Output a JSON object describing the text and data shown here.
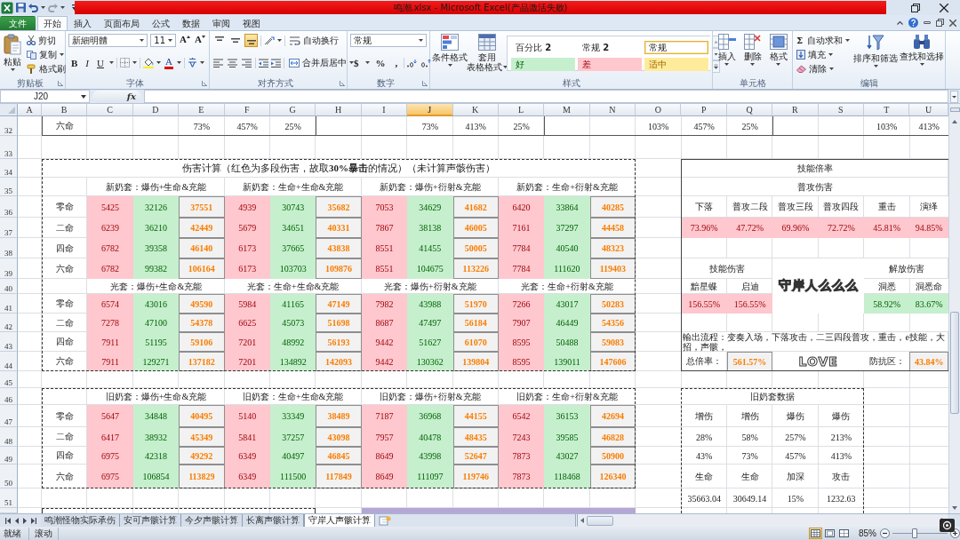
{
  "window": {
    "title": "鸣潮.xlsx - Microsoft Excel(产品激活失败)"
  },
  "ribbon_tabs": [
    {
      "label": "文件",
      "kind": "file",
      "selected": false
    },
    {
      "label": "开始",
      "kind": "tab",
      "selected": true
    },
    {
      "label": "插入",
      "kind": "tab",
      "selected": false
    },
    {
      "label": "页面布局",
      "kind": "tab",
      "selected": false
    },
    {
      "label": "公式",
      "kind": "tab",
      "selected": false
    },
    {
      "label": "数据",
      "kind": "tab",
      "selected": false
    },
    {
      "label": "审阅",
      "kind": "tab",
      "selected": false
    },
    {
      "label": "视图",
      "kind": "tab",
      "selected": false
    }
  ],
  "ribbon": {
    "clipboard": {
      "label": "剪贴板",
      "paste": "粘贴",
      "cut": "剪切",
      "copy": "复制",
      "format_painter": "格式刷"
    },
    "font": {
      "label": "字体",
      "name": "新細明體",
      "size": "11",
      "grow": "A",
      "shrink": "A",
      "styles": [
        "B",
        "I",
        "U"
      ],
      "font_color_letter": "A"
    },
    "alignment": {
      "label": "对齐方式",
      "vertical_align": [
        {
          "selected": false
        },
        {
          "selected": false
        },
        {
          "selected": true
        }
      ],
      "wrap_text": "自动换行",
      "merge_center": "合并后居中"
    },
    "number": {
      "label": "数字",
      "format": "常规",
      "symbols": [
        "$",
        "%",
        ","
      ]
    },
    "styles": {
      "label": "样式",
      "conditional_formatting": "条件格式",
      "format_as_table": [
        "套用",
        "表格格式"
      ],
      "gallery": [
        {
          "label": "百分比 **2**",
          "kind": "plain",
          "selected": false
        },
        {
          "label": "常规 **2**",
          "kind": "plain",
          "selected": false
        },
        {
          "label": "常规",
          "kind": "plain",
          "selected": true
        },
        {
          "label": "好",
          "kind": "good",
          "selected": false
        },
        {
          "label": "差",
          "kind": "bad",
          "selected": false
        },
        {
          "label": "适中",
          "kind": "neutral",
          "selected": false
        }
      ]
    },
    "cells": {
      "label": "单元格",
      "buttons": [
        "插入",
        "删除",
        "格式"
      ]
    },
    "editing": {
      "label": "编辑",
      "autosum_symbol": "Σ",
      "autosum": "自动求和",
      "fill": "填充",
      "clear": "清除",
      "sort_filter": "排序和筛选",
      "find_select": "查找和选择"
    }
  },
  "formula_bar": {
    "name_box": "J20",
    "function_button": "fx"
  },
  "column_headers": [
    {
      "label": "A",
      "selected": false
    },
    {
      "label": "B",
      "selected": false
    },
    {
      "label": "C",
      "selected": false
    },
    {
      "label": "D",
      "selected": false
    },
    {
      "label": "E",
      "selected": false
    },
    {
      "label": "F",
      "selected": false
    },
    {
      "label": "G",
      "selected": false
    },
    {
      "label": "H",
      "selected": false
    },
    {
      "label": "I",
      "selected": false
    },
    {
      "label": "J",
      "selected": true
    },
    {
      "label": "K",
      "selected": false
    },
    {
      "label": "L",
      "selected": false
    },
    {
      "label": "M",
      "selected": false
    },
    {
      "label": "N",
      "selected": false
    },
    {
      "label": "O",
      "selected": false
    },
    {
      "label": "P",
      "selected": false
    },
    {
      "label": "Q",
      "selected": false
    },
    {
      "label": "R",
      "selected": false
    },
    {
      "label": "S",
      "selected": false
    },
    {
      "label": "T",
      "selected": false
    },
    {
      "label": "U",
      "selected": false
    }
  ],
  "row_headers": [
    "32",
    "33",
    "34",
    "35",
    "36",
    "37",
    "38",
    "39",
    "40",
    "41",
    "42",
    "43",
    "44",
    "45",
    "46",
    "47",
    "48",
    "49",
    "50",
    "51"
  ],
  "row_32": {
    "label": "六命",
    "cells": [
      "73%",
      "457%",
      "25%",
      "73%",
      "413%",
      "25%",
      "103%",
      "457%",
      "25%",
      "103%",
      "413%"
    ]
  },
  "damage_table": {
    "title": "伤害计算（红色为多段伤害，故取**30%暴击**的情况）（未计算声骸伤害）",
    "sections": [
      {
        "headers": [
          "新奶套：爆伤+生命&充能",
          "新奶套：生命+生命&充能",
          "新奶套：爆伤+衍射&充能",
          "新奶套：生命+衍射&充能"
        ],
        "rows": [
          {
            "label": "零命",
            "groups": [
              [
                "5425",
                "32126",
                "37551"
              ],
              [
                "4939",
                "30743",
                "35682"
              ],
              [
                "7053",
                "34629",
                "41682"
              ],
              [
                "6420",
                "33864",
                "40285"
              ]
            ]
          },
          {
            "label": "二命",
            "groups": [
              [
                "6239",
                "36210",
                "42449"
              ],
              [
                "5679",
                "34651",
                "40331"
              ],
              [
                "7867",
                "38138",
                "46005"
              ],
              [
                "7161",
                "37297",
                "44458"
              ]
            ]
          },
          {
            "label": "四命",
            "groups": [
              [
                "6782",
                "39358",
                "46140"
              ],
              [
                "6173",
                "37665",
                "43838"
              ],
              [
                "8551",
                "41455",
                "50005"
              ],
              [
                "7784",
                "40540",
                "48323"
              ]
            ]
          },
          {
            "label": "六命",
            "groups": [
              [
                "6782",
                "99382",
                "106164"
              ],
              [
                "6173",
                "103703",
                "109876"
              ],
              [
                "8551",
                "104675",
                "113226"
              ],
              [
                "7784",
                "111620",
                "119403"
              ]
            ]
          }
        ]
      },
      {
        "headers": [
          "光套：爆伤+生命&充能",
          "光套：生命+生命&充能",
          "光套：爆伤+衍射&充能",
          "光套：生命+衍射&充能"
        ],
        "rows": [
          {
            "label": "零命",
            "groups": [
              [
                "6574",
                "43016",
                "49590"
              ],
              [
                "5984",
                "41165",
                "47149"
              ],
              [
                "7982",
                "43988",
                "51970"
              ],
              [
                "7266",
                "43017",
                "50283"
              ]
            ]
          },
          {
            "label": "二命",
            "groups": [
              [
                "7278",
                "47100",
                "54378"
              ],
              [
                "6625",
                "45073",
                "51698"
              ],
              [
                "8687",
                "47497",
                "56184"
              ],
              [
                "7907",
                "46449",
                "54356"
              ]
            ]
          },
          {
            "label": "四命",
            "groups": [
              [
                "7911",
                "51195",
                "59106"
              ],
              [
                "7201",
                "48992",
                "56193"
              ],
              [
                "9442",
                "51627",
                "61070"
              ],
              [
                "8595",
                "50488",
                "59083"
              ]
            ]
          },
          {
            "label": "六命",
            "groups": [
              [
                "7911",
                "129271",
                "137182"
              ],
              [
                "7201",
                "134892",
                "142093"
              ],
              [
                "9442",
                "130362",
                "139804"
              ],
              [
                "8595",
                "139011",
                "147606"
              ]
            ]
          }
        ]
      }
    ]
  },
  "old_set_table": {
    "headers": [
      "旧奶套：爆伤+生命&充能",
      "旧奶套：生命+生命&充能",
      "旧奶套：爆伤+衍射&充能",
      "旧奶套：生命+衍射&充能"
    ],
    "rows": [
      {
        "label": "零命",
        "groups": [
          [
            "5647",
            "34848",
            "40495"
          ],
          [
            "5140",
            "33349",
            "38489"
          ],
          [
            "7187",
            "36968",
            "44155"
          ],
          [
            "6542",
            "36153",
            "42694"
          ]
        ]
      },
      {
        "label": "二命",
        "groups": [
          [
            "6417",
            "38932",
            "45349"
          ],
          [
            "5841",
            "37257",
            "43098"
          ],
          [
            "7957",
            "40478",
            "48435"
          ],
          [
            "7243",
            "39585",
            "46828"
          ]
        ]
      },
      {
        "label": "四命",
        "groups": [
          [
            "6975",
            "42318",
            "49292"
          ],
          [
            "6349",
            "40497",
            "46845"
          ],
          [
            "8649",
            "43998",
            "52647"
          ],
          [
            "7873",
            "43027",
            "50900"
          ]
        ]
      },
      {
        "label": "六命",
        "groups": [
          [
            "6975",
            "106854",
            "113829"
          ],
          [
            "6349",
            "111500",
            "117849"
          ],
          [
            "8649",
            "111097",
            "119746"
          ],
          [
            "7873",
            "118468",
            "126340"
          ]
        ]
      }
    ]
  },
  "skill_table": {
    "title": "技能倍率",
    "normal_attack": {
      "title": "普攻伤害",
      "columns": [
        "下落",
        "普攻二段",
        "普攻三段",
        "普攻四段",
        "重击",
        "演绎"
      ],
      "values": [
        "73.96%",
        "47.72%",
        "69.96%",
        "72.72%",
        "45.81%",
        "94.85%"
      ]
    },
    "skill_damage": {
      "title": "技能伤害",
      "columns": [
        "黯星蝶",
        "启迪"
      ],
      "values": [
        "156.55%",
        "156.55%"
      ]
    },
    "liberation_damage": {
      "title": "解放伤害",
      "columns": [
        "洞悉",
        "洞悉命"
      ],
      "values": [
        "58.92%",
        "83.67%"
      ]
    },
    "center_art_text": "守岸人么么么",
    "output_flow": "輸出流程：变奏入场，下落攻击，二三四段普攻，重击，e技能，大招，声骸，",
    "total_label": "总倍率：",
    "total_value": "561.57%",
    "bottom_art_text": "LOVE",
    "defense_label": "防抗区：",
    "defense_value": "43.84%"
  },
  "old_set_data": {
    "title": "旧奶套数据",
    "rows": [
      [
        "增伤",
        "增伤",
        "爆伤",
        "爆伤"
      ],
      [
        "28%",
        "58%",
        "257%",
        "213%"
      ],
      [
        "43%",
        "73%",
        "457%",
        "413%"
      ],
      [
        "生命",
        "生命",
        "加深",
        "攻击"
      ],
      [
        "35663.04",
        "30649.14",
        "15%",
        "1232.63"
      ]
    ]
  },
  "sheet_tabs": [
    {
      "label": "鸣潮怪物实际承伤",
      "selected": false
    },
    {
      "label": "安可声骸计算",
      "selected": false
    },
    {
      "label": "今夕声骸计算",
      "selected": false
    },
    {
      "label": "长离声骸计算",
      "selected": false
    },
    {
      "label": "守岸人声骸计算",
      "selected": true
    }
  ],
  "status_bar": {
    "ready": "就绪",
    "scroll_lock": "滚动",
    "views": [
      {
        "selected": true
      },
      {
        "selected": false
      },
      {
        "selected": false
      }
    ],
    "zoom": "85%",
    "zoom_slider": {
      "level": 0.4
    }
  }
}
